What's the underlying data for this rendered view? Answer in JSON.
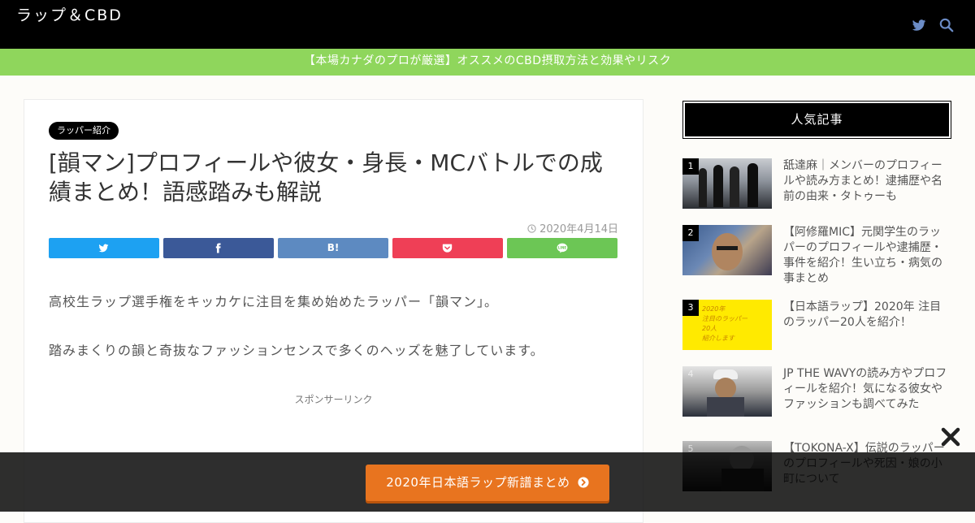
{
  "site": {
    "title": "ラップ＆CBD"
  },
  "header_icons": [
    "twitter-icon",
    "search-icon"
  ],
  "notice": {
    "text": "【本場カナダのプロが厳選】オススメのCBD摂取方法と効果やリスク"
  },
  "article": {
    "category": "ラッパー紹介",
    "title": "[韻マン]プロフィールや彼女・身長・MCバトルでの成績まとめ！語感踏みも解説",
    "date": "2020年4月14日",
    "share_buttons": [
      {
        "name": "twitter",
        "color": "#1da1f2",
        "icon": "twitter-icon"
      },
      {
        "name": "facebook",
        "color": "#3b5998",
        "icon": "facebook-icon"
      },
      {
        "name": "hatena",
        "color": "#5d8ac1",
        "label": "B!",
        "icon": "hatena-icon"
      },
      {
        "name": "pocket",
        "color": "#ef3f56",
        "icon": "pocket-icon"
      },
      {
        "name": "line",
        "color": "#6cc655",
        "icon": "line-icon"
      }
    ],
    "paragraphs": [
      "高校生ラップ選手権をキッカケに注目を集め始めたラッパー「韻マン」。",
      "踏みまくりの韻と奇抜なファッションセンスで多くのヘッズを魅了しています。"
    ],
    "sponsor_label": "スポンサーリンク"
  },
  "sidebar": {
    "heading": "人気記事",
    "items": [
      {
        "rank": "1",
        "title": "舐達麻｜メンバーのプロフィールや読み方まとめ！逮捕歴や名前の由来・タトゥーも"
      },
      {
        "rank": "2",
        "title": "【阿修羅MIC】元関学生のラッパーのプロフィールや逮捕歴・事件を紹介！生い立ち・病気の事まとめ"
      },
      {
        "rank": "3",
        "title": "【日本語ラップ】2020年 注目のラッパー20人を紹介！",
        "thumb_text": "2020年\n注目のラッパー\n20人\n紹介します"
      },
      {
        "rank": "4",
        "title": "JP THE WAVYの読み方やプロフィールを紹介！気になる彼女やファッションも調べてみた"
      },
      {
        "rank": "5",
        "title": "【TOKONA-X】伝説のラッパーのプロフィールや死因・娘の小町について"
      }
    ]
  },
  "cta": {
    "label": "2020年日本語ラップ新譜まとめ"
  },
  "colors": {
    "accent_green": "#8fd65c",
    "cta_orange": "#e8741f",
    "header_bg": "#000000"
  }
}
